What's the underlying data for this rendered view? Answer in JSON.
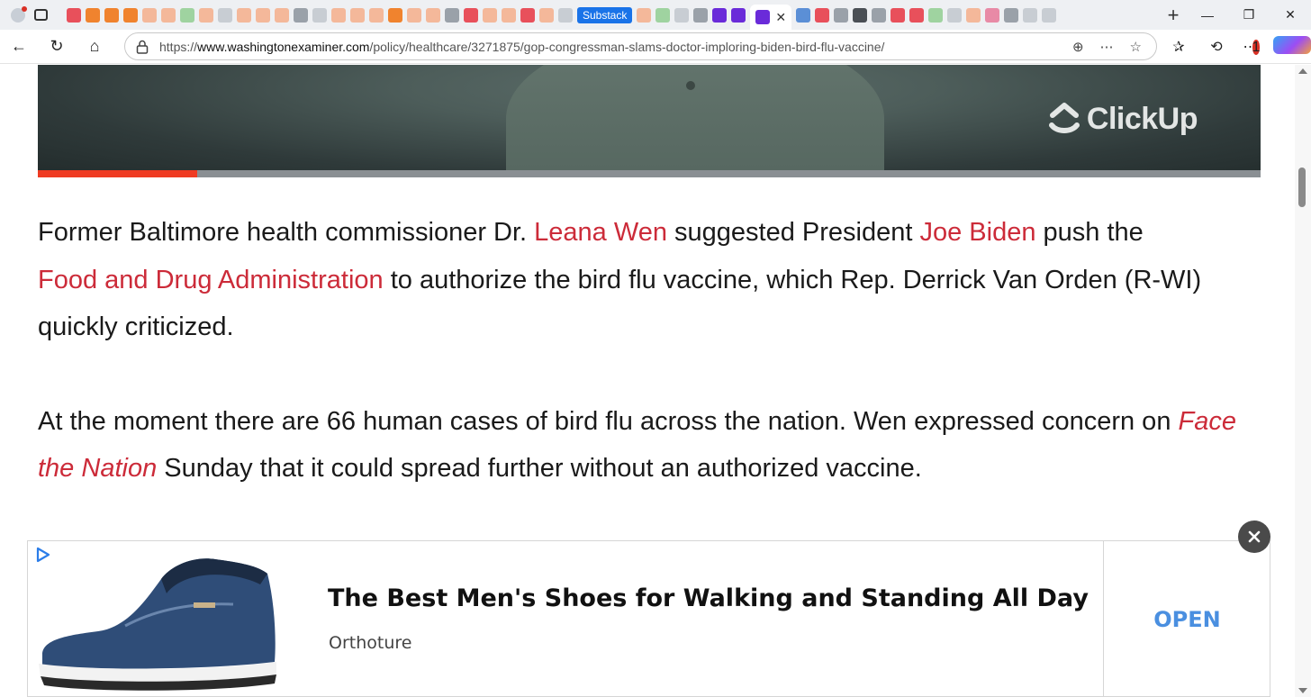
{
  "browser": {
    "tab_favicons": [
      "red",
      "orange",
      "orange",
      "orange",
      "peach",
      "peach",
      "green",
      "peach",
      "light",
      "peach",
      "peach",
      "peach",
      "gray",
      "light",
      "peach",
      "peach",
      "peach",
      "orange",
      "peach",
      "peach",
      "gray",
      "red",
      "peach",
      "peach",
      "red",
      "peach",
      "light"
    ],
    "substack_tab_label": "Substack",
    "tab_favicons_after": [
      "peach",
      "green",
      "light",
      "gray",
      "purple",
      "purple"
    ],
    "tab_favicons_tail": [
      "blue",
      "red",
      "gray",
      "dark",
      "gray",
      "red",
      "red",
      "green",
      "light",
      "peach",
      "pink",
      "gray",
      "light",
      "light"
    ],
    "url_prefix": "https://",
    "url_host": "www.washingtonexaminer.com",
    "url_path": "/policy/healthcare/3271875/gop-congressman-slams-doctor-imploring-biden-bird-flu-vaccine/",
    "notification_count": "1"
  },
  "video": {
    "brand_text": "ClickUp",
    "progress": 0.13
  },
  "article": {
    "p1": {
      "t1": "Former Baltimore health commissioner Dr. ",
      "link1": "Leana Wen",
      "t2": " suggested President ",
      "link2": "Joe Biden",
      "t3": " push the ",
      "link3": "Food and Drug Administration",
      "t4": " to authorize the bird flu vaccine, which Rep. Derrick Van Orden (R-WI) quickly criticized."
    },
    "p2": {
      "t1": "At the moment there are 66 human cases of bird flu across the nation. Wen expressed concern on ",
      "link1": "Face the Nation",
      "t2": " Sunday that it could spread further without an authorized vaccine."
    }
  },
  "ad": {
    "title": "The Best Men's Shoes for Walking and Standing All Day",
    "brand": "Orthoture",
    "cta": "OPEN",
    "accent_color": "#4a8fe0"
  }
}
